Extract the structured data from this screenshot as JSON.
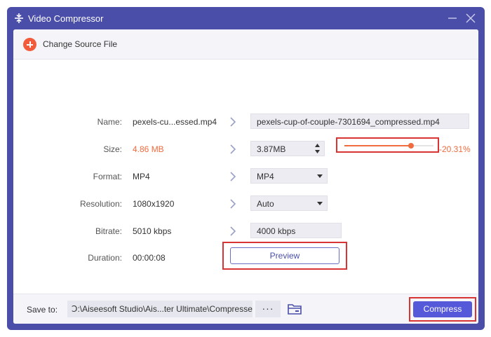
{
  "window": {
    "title": "Video Compressor"
  },
  "source_bar": {
    "change_source_label": "Change Source File"
  },
  "fields": {
    "name": {
      "label": "Name:",
      "source": "pexels-cu...essed.mp4",
      "output": "pexels-cup-of-couple-7301694_compressed.mp4"
    },
    "size": {
      "label": "Size:",
      "source": "4.86 MB",
      "output": "3.87MB",
      "slider_fraction": 0.75,
      "percent": "-20.31%"
    },
    "format": {
      "label": "Format:",
      "source": "MP4",
      "output": "MP4"
    },
    "resolution": {
      "label": "Resolution:",
      "source": "1080x1920",
      "output": "Auto"
    },
    "bitrate": {
      "label": "Bitrate:",
      "source": "5010 kbps",
      "output": "4000 kbps"
    },
    "duration": {
      "label": "Duration:",
      "source": "00:00:08"
    }
  },
  "buttons": {
    "preview": "Preview",
    "compress": "Compress",
    "more": "···"
  },
  "save": {
    "label": "Save to:",
    "path": "Ↄ:\\Aiseesoft Studio\\Ais...ter Ultimate\\Compressed"
  },
  "colors": {
    "accent": "#4a4ea8",
    "compress_button": "#5558d8",
    "orange": "#f06b3e",
    "highlight": "#d93434"
  },
  "icons": {
    "title": "compress-icon",
    "add": "plus-circle-icon",
    "arrow": "chevron-right-icon",
    "folder": "folder-icon"
  }
}
